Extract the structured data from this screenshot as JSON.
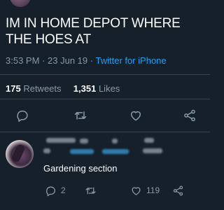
{
  "tweet": {
    "text": "IM IN HOME DEPOT WHERE THE HOES AT",
    "time": "3:53 PM",
    "sep": "·",
    "date": "23 Jun 19",
    "client": "Twitter for iPhone"
  },
  "stats": {
    "retweets_count": "175",
    "retweets_label": "Retweets",
    "likes_count": "1,351",
    "likes_label": "Likes"
  },
  "actions": [
    "reply-icon",
    "retweet-icon",
    "like-icon",
    "share-icon"
  ],
  "reply": {
    "text": "Gardening section",
    "reply_count": "2",
    "like_count": "119"
  },
  "colors": {
    "background": "#15202b",
    "muted": "#8899a6",
    "accent": "#1da1f2",
    "divider": "#38444d"
  }
}
